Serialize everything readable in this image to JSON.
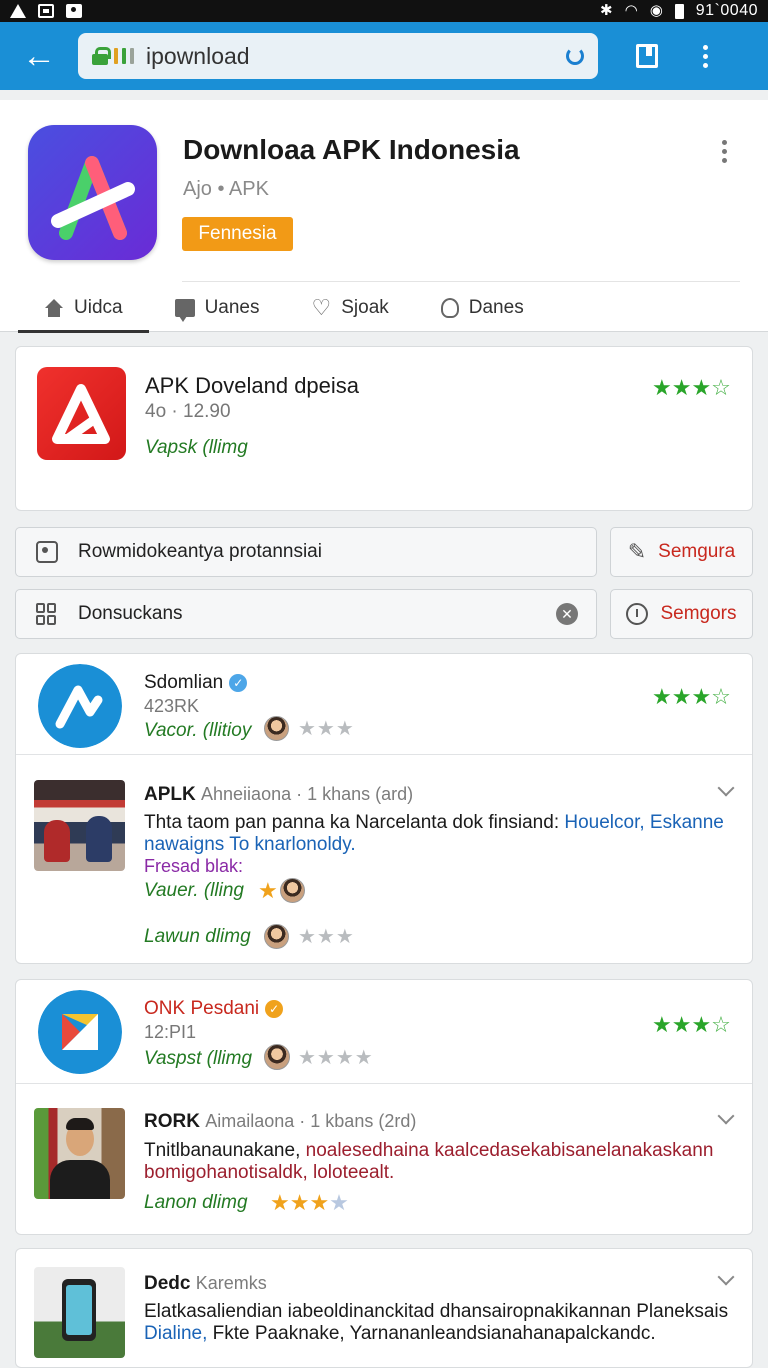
{
  "status_bar": {
    "time": "91`0040"
  },
  "browser": {
    "url": "ipownload"
  },
  "app": {
    "title": "Downloaa APK Indonesia",
    "subtitle": "Ajo • APK",
    "badge": "Fennesia",
    "tabs": [
      {
        "label": "Uidca",
        "icon": "home-icon",
        "active": true
      },
      {
        "label": "Uanes",
        "icon": "chat-icon"
      },
      {
        "label": "Sjoak",
        "icon": "heart-icon"
      },
      {
        "label": "Danes",
        "icon": "bulb-icon"
      }
    ]
  },
  "featured": {
    "title": "APK Doveland dpeisa",
    "meta": "4o · 12.90",
    "link": "Vapsk (llimg",
    "rating": 3
  },
  "actions": [
    {
      "text": "Rowmidokeantya protannsiai",
      "button": "Semgura",
      "icon": "square-icon"
    },
    {
      "text": "Donsuckans",
      "button": "Semgors",
      "icon": "grid-icon"
    }
  ],
  "list1": {
    "title": "Sdomlian",
    "meta": "423RK",
    "link": "Vacor. (llitioy",
    "rating": 3
  },
  "news1": {
    "head": "APLK",
    "source": "Ahneiiaona · 1 khans (ard)",
    "body_plain": "Thta taom pan panna ka Narcelanta dok finsiand: ",
    "body_blue1": "Houelcor, Eskanne",
    "body_blue2": "nawaigns To knarlonoldy.",
    "purple": "Fresad blak:",
    "link1": "Vauer. (lling",
    "link2": "Lawun dlimg"
  },
  "list2": {
    "title": "ONK Pesdani",
    "meta": "12:PI1",
    "link": "Vaspst (llimg",
    "rating": 3
  },
  "news2": {
    "head": "RORK",
    "source": "Aimailaona · 1 kbans (2rd)",
    "body_plain": "Tnitlbanaunakane, ",
    "body_maroon1": "noalesedhaina kaalcedasekabisanelanakaskann",
    "body_maroon2": "bomigohanotisaldk, loloteealt.",
    "link": "Lanon dlimg",
    "rating": 3
  },
  "news3": {
    "head": "Dedc",
    "source": "Karemks",
    "body_plain": "Elatkasaliendian iabeoldinanckitad dhansairopnakikannan Planeksais",
    "body_blue": "Dialine,",
    "body_plain2": " Fkte Paaknake, Yarnananleandsianahanapalckandc."
  }
}
